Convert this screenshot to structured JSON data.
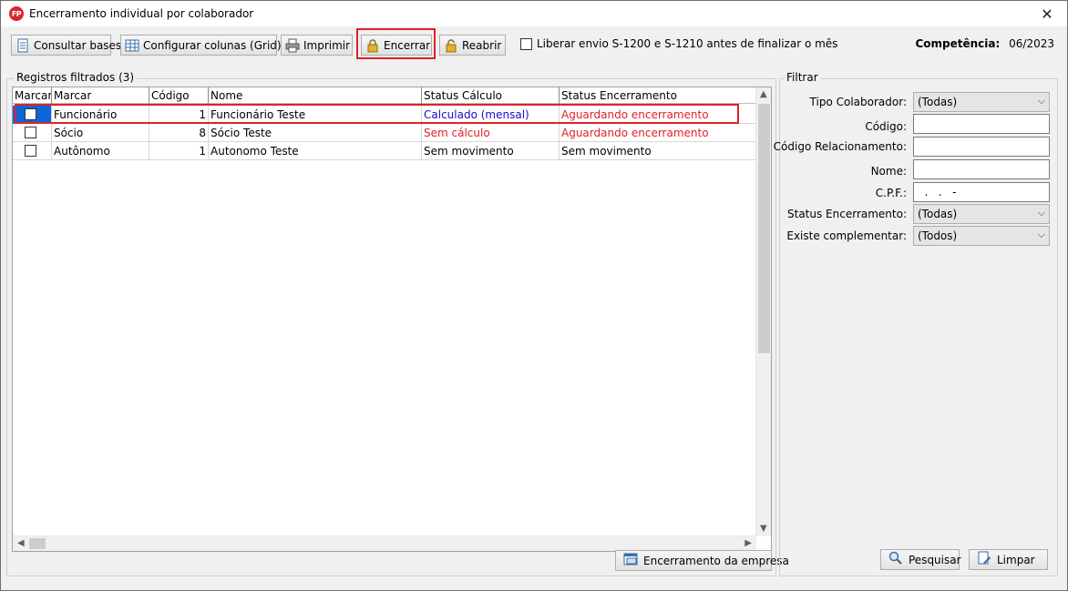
{
  "window": {
    "title": "Encerramento individual por colaborador",
    "app_icon_text": "FP",
    "close_symbol": "✕"
  },
  "toolbar": {
    "consultar_label": "Consultar bases",
    "configurar_label": "Configurar colunas (Grid)",
    "imprimir_label": "Imprimir",
    "encerrar_label": "Encerrar",
    "reabrir_label": "Reabrir",
    "liberar_label": "Liberar envio S-1200 e S-1210 antes de finalizar o mês",
    "competencia_label": "Competência:",
    "competencia_value": "06/2023"
  },
  "registros": {
    "group_label": "Registros filtrados (3)",
    "columns": [
      "Marcar",
      "Marcar",
      "Código",
      "Nome",
      "Status Cálculo",
      "Status Encerramento"
    ],
    "rows": [
      {
        "tipo": "Funcionário",
        "codigo": "1",
        "nome": "Funcionário Teste",
        "status_calculo": "Calculado (mensal)",
        "status_encerramento": "Aguardando encerramento"
      },
      {
        "tipo": "Sócio",
        "codigo": "8",
        "nome": "Sócio Teste",
        "status_calculo": "Sem cálculo",
        "status_encerramento": "Aguardando encerramento"
      },
      {
        "tipo": "Autônomo",
        "codigo": "1",
        "nome": "Autonomo Teste",
        "status_calculo": "Sem movimento",
        "status_encerramento": "Sem movimento"
      }
    ],
    "encerramento_empresa_label": "Encerramento da empresa"
  },
  "filtrar": {
    "group_label": "Filtrar",
    "tipo_colaborador_label": "Tipo Colaborador:",
    "tipo_colaborador_value": "(Todas)",
    "codigo_label": "Código:",
    "codigo_value": "",
    "codigo_relacionamento_label": "Código Relacionamento:",
    "codigo_relacionamento_value": "",
    "nome_label": "Nome:",
    "nome_value": "",
    "cpf_label": "C.P.F.:",
    "cpf_value": "  .   .   -",
    "status_encerramento_label": "Status Encerramento:",
    "status_encerramento_value": "(Todas)",
    "existe_complementar_label": "Existe complementar:",
    "existe_complementar_value": "(Todos)",
    "pesquisar_label": "Pesquisar",
    "limpar_label": "Limpar"
  },
  "colors": {
    "highlight": "#e0212a",
    "status_blue": "#1010c8",
    "status_red": "#e0212a"
  }
}
